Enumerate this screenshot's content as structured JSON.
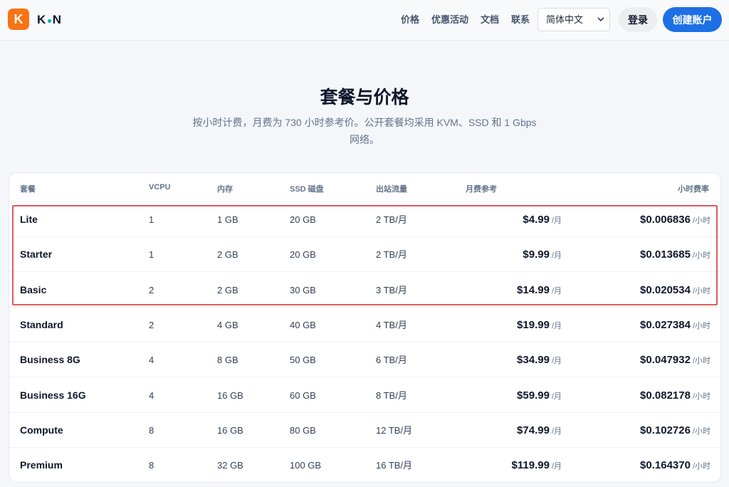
{
  "header": {
    "logo_letter": "K",
    "brand_left": "K",
    "brand_right": "N",
    "nav": [
      "价格",
      "优惠活动",
      "文档",
      "联系"
    ],
    "language": "简体中文",
    "login": "登录",
    "signup": "创建账户"
  },
  "hero": {
    "title": "套餐与价格",
    "subtitle": "按小时计费，月费为 730 小时参考价。公开套餐均采用 KVM、SSD 和 1 Gbps 网络。"
  },
  "table": {
    "columns": [
      "套餐",
      "VCPU",
      "内存",
      "SSD 磁盘",
      "出站流量",
      "月费参考",
      "小时费率"
    ],
    "month_unit": "/月",
    "hour_unit": "/小时",
    "rows": [
      {
        "name": "Lite",
        "vcpu": "1",
        "ram": "1 GB",
        "ssd": "20 GB",
        "traffic": "2 TB/月",
        "monthly": "$4.99",
        "hourly": "$0.006836"
      },
      {
        "name": "Starter",
        "vcpu": "1",
        "ram": "2 GB",
        "ssd": "20 GB",
        "traffic": "2 TB/月",
        "monthly": "$9.99",
        "hourly": "$0.013685"
      },
      {
        "name": "Basic",
        "vcpu": "2",
        "ram": "2 GB",
        "ssd": "30 GB",
        "traffic": "3 TB/月",
        "monthly": "$14.99",
        "hourly": "$0.020534"
      },
      {
        "name": "Standard",
        "vcpu": "2",
        "ram": "4 GB",
        "ssd": "40 GB",
        "traffic": "4 TB/月",
        "monthly": "$19.99",
        "hourly": "$0.027384"
      },
      {
        "name": "Business 8G",
        "vcpu": "4",
        "ram": "8 GB",
        "ssd": "50 GB",
        "traffic": "6 TB/月",
        "monthly": "$34.99",
        "hourly": "$0.047932"
      },
      {
        "name": "Business 16G",
        "vcpu": "4",
        "ram": "16 GB",
        "ssd": "60 GB",
        "traffic": "8 TB/月",
        "monthly": "$59.99",
        "hourly": "$0.082178"
      },
      {
        "name": "Compute",
        "vcpu": "8",
        "ram": "16 GB",
        "ssd": "80 GB",
        "traffic": "12 TB/月",
        "monthly": "$74.99",
        "hourly": "$0.102726"
      },
      {
        "name": "Premium",
        "vcpu": "8",
        "ram": "32 GB",
        "ssd": "100 GB",
        "traffic": "16 TB/月",
        "monthly": "$119.99",
        "hourly": "$0.164370"
      }
    ]
  },
  "colors": {
    "accent": "#1d6fe6",
    "logo": "#f97316",
    "highlight": "#e05b5b"
  }
}
